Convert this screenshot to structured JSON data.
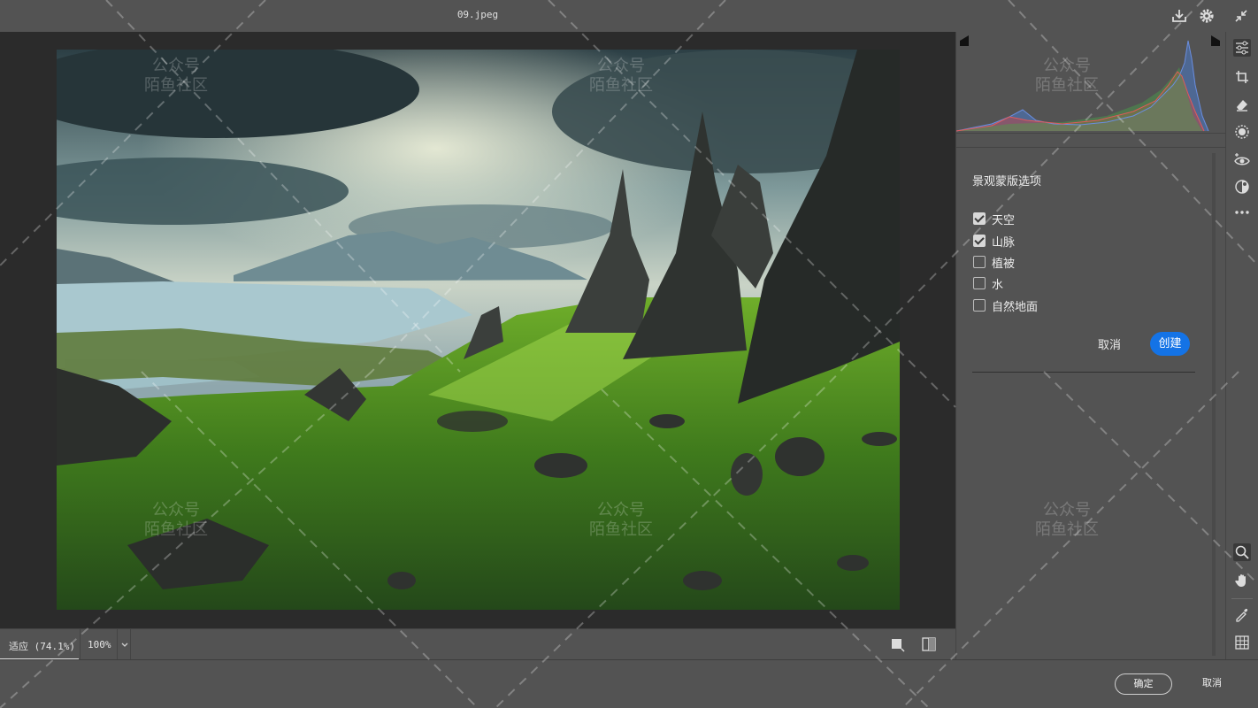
{
  "window": {
    "filename": "09.jpeg"
  },
  "topbar_icons": [
    "export-icon",
    "gear-icon",
    "collapse-icon"
  ],
  "canvas": {
    "zoom_fit_label": "适应 (74.1%)",
    "zoom_100_label": "100%"
  },
  "panel": {
    "title": "景观蒙版选项",
    "options": [
      {
        "label": "天空",
        "checked": true
      },
      {
        "label": "山脉",
        "checked": true
      },
      {
        "label": "植被",
        "checked": false
      },
      {
        "label": "水",
        "checked": false
      },
      {
        "label": "自然地面",
        "checked": false
      }
    ],
    "cancel_label": "取消",
    "create_label": "创建"
  },
  "footer": {
    "ok_label": "确定",
    "cancel_label": "取消"
  },
  "watermark": {
    "line1": "公众号",
    "line2": "陌鱼社区"
  },
  "colors": {
    "accent": "#1473e6",
    "panel": "#535353",
    "canvas": "#2b2b2b"
  }
}
